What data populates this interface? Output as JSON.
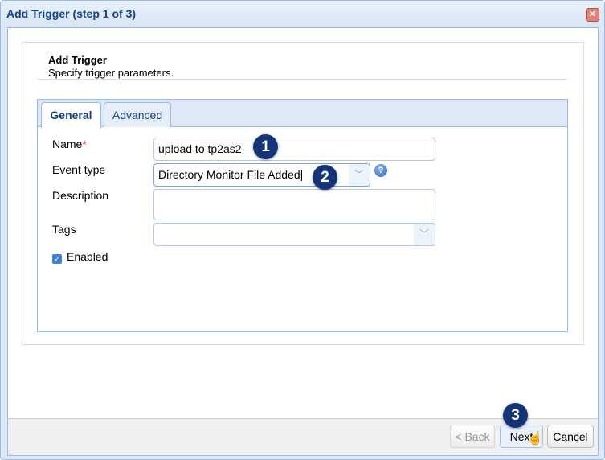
{
  "window": {
    "title": "Add Trigger (step 1 of 3)",
    "close_icon": "close-icon"
  },
  "header": {
    "title": "Add Trigger",
    "subtitle": "Specify trigger parameters."
  },
  "tabs": [
    {
      "label": "General",
      "active": true
    },
    {
      "label": "Advanced",
      "active": false
    }
  ],
  "form": {
    "name": {
      "label": "Name",
      "required_mark": "*",
      "value": "upload to tp2as2"
    },
    "event_type": {
      "label": "Event type",
      "value": "Directory Monitor File Added",
      "help": "?"
    },
    "description": {
      "label": "Description",
      "value": ""
    },
    "tags": {
      "label": "Tags",
      "value": ""
    },
    "enabled": {
      "label": "Enabled",
      "checked": true
    }
  },
  "buttons": {
    "back": "< Back",
    "next": "Next",
    "cancel": "Cancel"
  },
  "badges": [
    "1",
    "2",
    "3"
  ],
  "colors": {
    "accent": "#15428b",
    "badge": "#14347a"
  }
}
